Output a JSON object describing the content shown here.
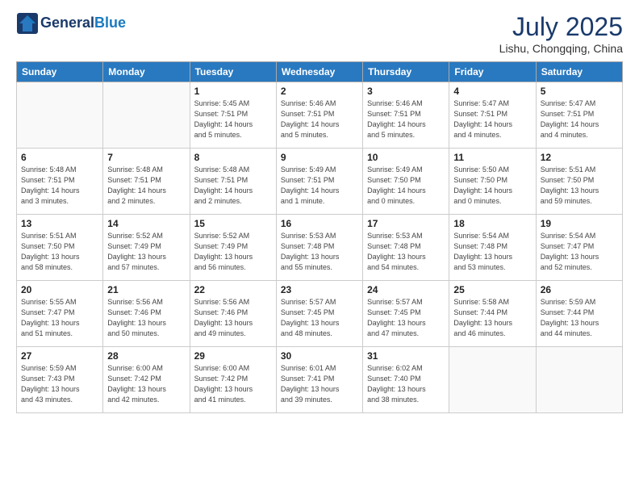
{
  "header": {
    "logo_line1": "General",
    "logo_line2": "Blue",
    "month": "July 2025",
    "location": "Lishu, Chongqing, China"
  },
  "weekdays": [
    "Sunday",
    "Monday",
    "Tuesday",
    "Wednesday",
    "Thursday",
    "Friday",
    "Saturday"
  ],
  "weeks": [
    [
      {
        "day": "",
        "info": ""
      },
      {
        "day": "",
        "info": ""
      },
      {
        "day": "1",
        "info": "Sunrise: 5:45 AM\nSunset: 7:51 PM\nDaylight: 14 hours\nand 5 minutes."
      },
      {
        "day": "2",
        "info": "Sunrise: 5:46 AM\nSunset: 7:51 PM\nDaylight: 14 hours\nand 5 minutes."
      },
      {
        "day": "3",
        "info": "Sunrise: 5:46 AM\nSunset: 7:51 PM\nDaylight: 14 hours\nand 5 minutes."
      },
      {
        "day": "4",
        "info": "Sunrise: 5:47 AM\nSunset: 7:51 PM\nDaylight: 14 hours\nand 4 minutes."
      },
      {
        "day": "5",
        "info": "Sunrise: 5:47 AM\nSunset: 7:51 PM\nDaylight: 14 hours\nand 4 minutes."
      }
    ],
    [
      {
        "day": "6",
        "info": "Sunrise: 5:48 AM\nSunset: 7:51 PM\nDaylight: 14 hours\nand 3 minutes."
      },
      {
        "day": "7",
        "info": "Sunrise: 5:48 AM\nSunset: 7:51 PM\nDaylight: 14 hours\nand 2 minutes."
      },
      {
        "day": "8",
        "info": "Sunrise: 5:48 AM\nSunset: 7:51 PM\nDaylight: 14 hours\nand 2 minutes."
      },
      {
        "day": "9",
        "info": "Sunrise: 5:49 AM\nSunset: 7:51 PM\nDaylight: 14 hours\nand 1 minute."
      },
      {
        "day": "10",
        "info": "Sunrise: 5:49 AM\nSunset: 7:50 PM\nDaylight: 14 hours\nand 0 minutes."
      },
      {
        "day": "11",
        "info": "Sunrise: 5:50 AM\nSunset: 7:50 PM\nDaylight: 14 hours\nand 0 minutes."
      },
      {
        "day": "12",
        "info": "Sunrise: 5:51 AM\nSunset: 7:50 PM\nDaylight: 13 hours\nand 59 minutes."
      }
    ],
    [
      {
        "day": "13",
        "info": "Sunrise: 5:51 AM\nSunset: 7:50 PM\nDaylight: 13 hours\nand 58 minutes."
      },
      {
        "day": "14",
        "info": "Sunrise: 5:52 AM\nSunset: 7:49 PM\nDaylight: 13 hours\nand 57 minutes."
      },
      {
        "day": "15",
        "info": "Sunrise: 5:52 AM\nSunset: 7:49 PM\nDaylight: 13 hours\nand 56 minutes."
      },
      {
        "day": "16",
        "info": "Sunrise: 5:53 AM\nSunset: 7:48 PM\nDaylight: 13 hours\nand 55 minutes."
      },
      {
        "day": "17",
        "info": "Sunrise: 5:53 AM\nSunset: 7:48 PM\nDaylight: 13 hours\nand 54 minutes."
      },
      {
        "day": "18",
        "info": "Sunrise: 5:54 AM\nSunset: 7:48 PM\nDaylight: 13 hours\nand 53 minutes."
      },
      {
        "day": "19",
        "info": "Sunrise: 5:54 AM\nSunset: 7:47 PM\nDaylight: 13 hours\nand 52 minutes."
      }
    ],
    [
      {
        "day": "20",
        "info": "Sunrise: 5:55 AM\nSunset: 7:47 PM\nDaylight: 13 hours\nand 51 minutes."
      },
      {
        "day": "21",
        "info": "Sunrise: 5:56 AM\nSunset: 7:46 PM\nDaylight: 13 hours\nand 50 minutes."
      },
      {
        "day": "22",
        "info": "Sunrise: 5:56 AM\nSunset: 7:46 PM\nDaylight: 13 hours\nand 49 minutes."
      },
      {
        "day": "23",
        "info": "Sunrise: 5:57 AM\nSunset: 7:45 PM\nDaylight: 13 hours\nand 48 minutes."
      },
      {
        "day": "24",
        "info": "Sunrise: 5:57 AM\nSunset: 7:45 PM\nDaylight: 13 hours\nand 47 minutes."
      },
      {
        "day": "25",
        "info": "Sunrise: 5:58 AM\nSunset: 7:44 PM\nDaylight: 13 hours\nand 46 minutes."
      },
      {
        "day": "26",
        "info": "Sunrise: 5:59 AM\nSunset: 7:44 PM\nDaylight: 13 hours\nand 44 minutes."
      }
    ],
    [
      {
        "day": "27",
        "info": "Sunrise: 5:59 AM\nSunset: 7:43 PM\nDaylight: 13 hours\nand 43 minutes."
      },
      {
        "day": "28",
        "info": "Sunrise: 6:00 AM\nSunset: 7:42 PM\nDaylight: 13 hours\nand 42 minutes."
      },
      {
        "day": "29",
        "info": "Sunrise: 6:00 AM\nSunset: 7:42 PM\nDaylight: 13 hours\nand 41 minutes."
      },
      {
        "day": "30",
        "info": "Sunrise: 6:01 AM\nSunset: 7:41 PM\nDaylight: 13 hours\nand 39 minutes."
      },
      {
        "day": "31",
        "info": "Sunrise: 6:02 AM\nSunset: 7:40 PM\nDaylight: 13 hours\nand 38 minutes."
      },
      {
        "day": "",
        "info": ""
      },
      {
        "day": "",
        "info": ""
      }
    ]
  ]
}
